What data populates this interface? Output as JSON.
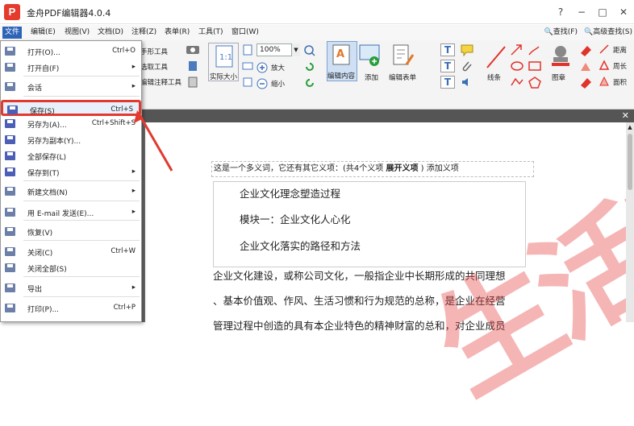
{
  "app": {
    "title": "金舟PDF编辑器4.0.4",
    "logo_letter": "P",
    "brand_color": "#e53b2c"
  },
  "window_controls": {
    "help": "?",
    "minimize": "−",
    "maximize": "□",
    "close": "✕"
  },
  "menubar": {
    "items": [
      "文件",
      "编辑(E)",
      "视图(V)",
      "文档(D)",
      "注释(Z)",
      "表单(R)",
      "工具(T)",
      "窗口(W)"
    ],
    "find": "查找(F)",
    "advanced_find": "高级查找(S)"
  },
  "ribbon": {
    "hand_tool": "手形工具",
    "select_tool": "选取工具",
    "edit_annot_tool": "编辑注释工具",
    "actual_size": "实际大小",
    "zoom_value": "100%",
    "zoom_in": "放大",
    "zoom_out": "缩小",
    "edit_content": "编辑内容",
    "add": "添加",
    "edit_form": "编辑表单",
    "line": "线条",
    "stamp": "图章",
    "distance": "距离",
    "perimeter": "周长",
    "area": "面积"
  },
  "document": {
    "edit_line_prefix": "这是一个多义词，它还有其它义项：(共4个义项 ",
    "edit_line_bold": "展开义项",
    "edit_line_suffix": " ) 添加义项",
    "headings": [
      "企业文化理念塑造过程",
      "模块一：企业文化人心化",
      "企业文化落实的路径和方法"
    ],
    "body_lines": [
      "企业文化建设，或称公司文化，一般指企业中长期形成的共同理想",
      "、基本价值观、作风、生活习惯和行为规范的总称，是企业在经营",
      "管理过程中创造的具有本企业特色的精神财富的总和，对企业成员"
    ],
    "watermark": "生活吧"
  },
  "file_menu": {
    "items": [
      {
        "label": "打开(O)...",
        "shortcut": "Ctrl+O",
        "arrow": "▸"
      },
      {
        "label": "打开自(F)",
        "shortcut": "",
        "arrow": "▸"
      },
      {
        "label": "会话",
        "shortcut": "",
        "arrow": "▸"
      },
      {
        "label": "保存(S)",
        "shortcut": "Ctrl+S",
        "arrow": ""
      },
      {
        "label": "另存为(A)...",
        "shortcut": "Ctrl+Shift+S",
        "arrow": ""
      },
      {
        "label": "另存为副本(Y)...",
        "shortcut": "",
        "arrow": ""
      },
      {
        "label": "全部保存(L)",
        "shortcut": "",
        "arrow": ""
      },
      {
        "label": "保存到(T)",
        "shortcut": "",
        "arrow": "▸"
      },
      {
        "label": "新建文档(N)",
        "shortcut": "",
        "arrow": "▸"
      },
      {
        "label": "用 E-mail 发送(E)...",
        "shortcut": "",
        "arrow": "▸"
      },
      {
        "label": "恢复(V)",
        "shortcut": "",
        "arrow": ""
      },
      {
        "label": "关闭(C)",
        "shortcut": "Ctrl+W",
        "arrow": ""
      },
      {
        "label": "关闭全部(S)",
        "shortcut": "",
        "arrow": ""
      },
      {
        "label": "导出",
        "shortcut": "",
        "arrow": "▸"
      },
      {
        "label": "打印(P)...",
        "shortcut": "Ctrl+P",
        "arrow": ""
      }
    ]
  },
  "colors": {
    "menu_highlight": "#2e64b8",
    "annotation_red": "#e23a2f",
    "doc_bg": "#6d6d6d"
  }
}
